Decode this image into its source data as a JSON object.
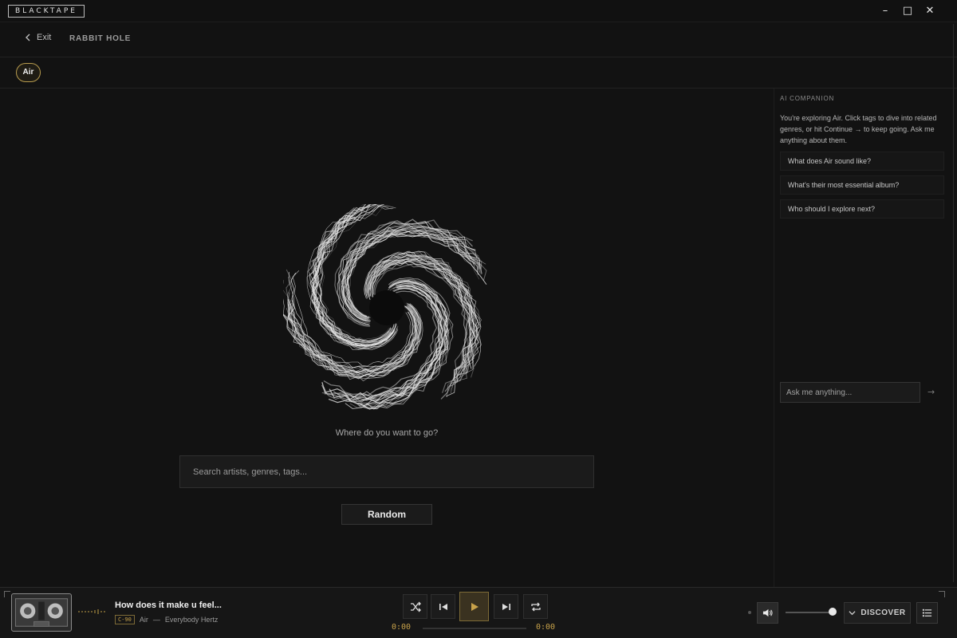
{
  "app": {
    "logo": "BLACKTAPE"
  },
  "window_controls": {
    "minimize": "–",
    "maximize": "□",
    "close": "✕"
  },
  "nav": {
    "exit_label": "Exit",
    "title": "RABBIT HOLE"
  },
  "tags": {
    "active": "Air"
  },
  "main": {
    "prompt": "Where do you want to go?",
    "search_placeholder": "Search artists, genres, tags...",
    "random_label": "Random"
  },
  "companion": {
    "header": "AI COMPANION",
    "intro": "You're exploring Air. Click tags to dive into related genres, or hit Continue → to keep going. Ask me anything about them.",
    "suggestions": [
      "What does Air sound like?",
      "What's their most essential album?",
      "Who should I explore next?"
    ],
    "ask_placeholder": "Ask me anything...",
    "send_icon": "→"
  },
  "player": {
    "track_title": "How does it make u feel...",
    "format_badge": "C-90",
    "artist": "Air",
    "separator": "—",
    "album": "Everybody Hertz",
    "time_elapsed": "0:00",
    "time_total": "0:00",
    "progress": 0,
    "volume": 0.9,
    "discover_label": "DISCOVER"
  },
  "colors": {
    "accent": "#c8a24a",
    "background": "#121212",
    "panel": "#161616"
  }
}
